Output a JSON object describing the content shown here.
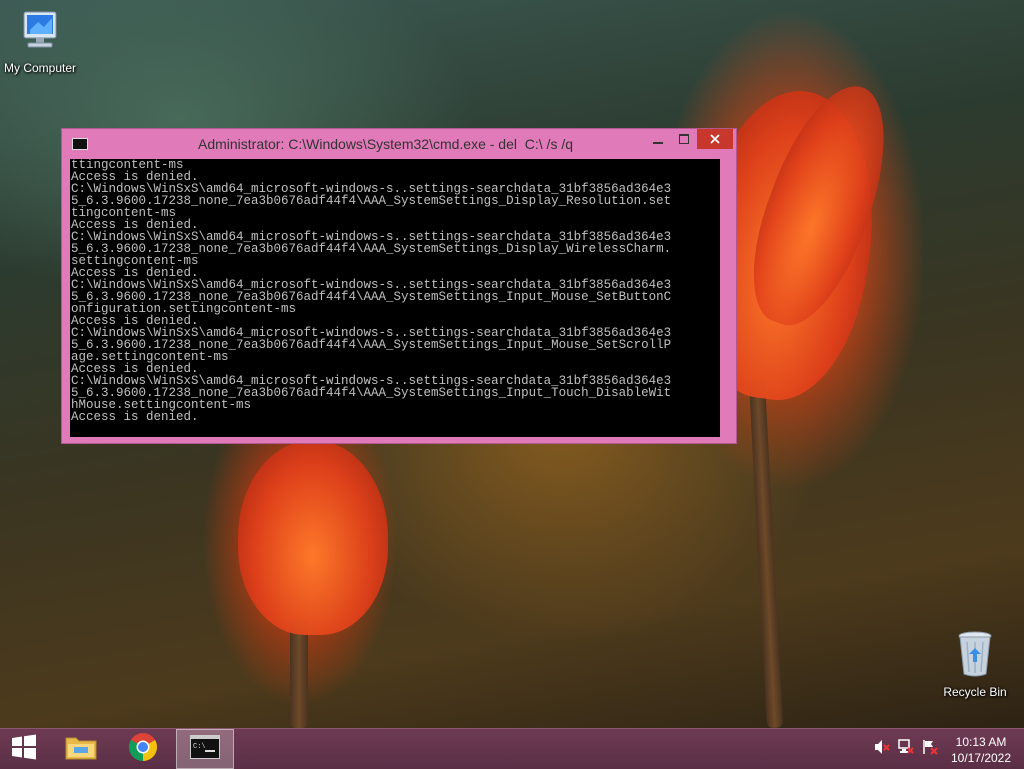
{
  "desktop": {
    "icons": [
      {
        "label": "My Computer",
        "icon": "computer-icon"
      },
      {
        "label": "Recycle Bin",
        "icon": "recycle-bin-icon"
      }
    ]
  },
  "cmd_window": {
    "title": "Administrator: C:\\Windows\\System32\\cmd.exe - del  C:\\ /s /q",
    "buttons": {
      "minimize": "minimize-icon",
      "maximize": "maximize-icon",
      "close": "close-icon"
    },
    "output_lines": [
      "ttingcontent-ms",
      "Access is denied.",
      "C:\\Windows\\WinSxS\\amd64_microsoft-windows-s..settings-searchdata_31bf3856ad364e3",
      "5_6.3.9600.17238_none_7ea3b0676adf44f4\\AAA_SystemSettings_Display_Resolution.set",
      "tingcontent-ms",
      "Access is denied.",
      "C:\\Windows\\WinSxS\\amd64_microsoft-windows-s..settings-searchdata_31bf3856ad364e3",
      "5_6.3.9600.17238_none_7ea3b0676adf44f4\\AAA_SystemSettings_Display_WirelessCharm.",
      "settingcontent-ms",
      "Access is denied.",
      "C:\\Windows\\WinSxS\\amd64_microsoft-windows-s..settings-searchdata_31bf3856ad364e3",
      "5_6.3.9600.17238_none_7ea3b0676adf44f4\\AAA_SystemSettings_Input_Mouse_SetButtonC",
      "onfiguration.settingcontent-ms",
      "Access is denied.",
      "C:\\Windows\\WinSxS\\amd64_microsoft-windows-s..settings-searchdata_31bf3856ad364e3",
      "5_6.3.9600.17238_none_7ea3b0676adf44f4\\AAA_SystemSettings_Input_Mouse_SetScrollP",
      "age.settingcontent-ms",
      "Access is denied.",
      "C:\\Windows\\WinSxS\\amd64_microsoft-windows-s..settings-searchdata_31bf3856ad364e3",
      "5_6.3.9600.17238_none_7ea3b0676adf44f4\\AAA_SystemSettings_Input_Touch_DisableWit",
      "hMouse.settingcontent-ms",
      "Access is denied."
    ]
  },
  "taskbar": {
    "pinned": [
      {
        "name": "start",
        "icon": "windows-logo-icon"
      },
      {
        "name": "file-explorer",
        "icon": "folder-icon"
      },
      {
        "name": "chrome",
        "icon": "chrome-icon"
      },
      {
        "name": "command-prompt",
        "icon": "cmd-icon",
        "active": true
      }
    ],
    "tray": {
      "icons": [
        "volume-muted-icon",
        "network-icon",
        "action-center-flag-icon"
      ],
      "time": "10:13 AM",
      "date": "10/17/2022"
    }
  },
  "colors": {
    "window_frame": "#e07ab8",
    "close_button": "#c7372c",
    "taskbar": "#5a2f46",
    "console_bg": "#000000",
    "console_text": "#c0c0c0"
  }
}
